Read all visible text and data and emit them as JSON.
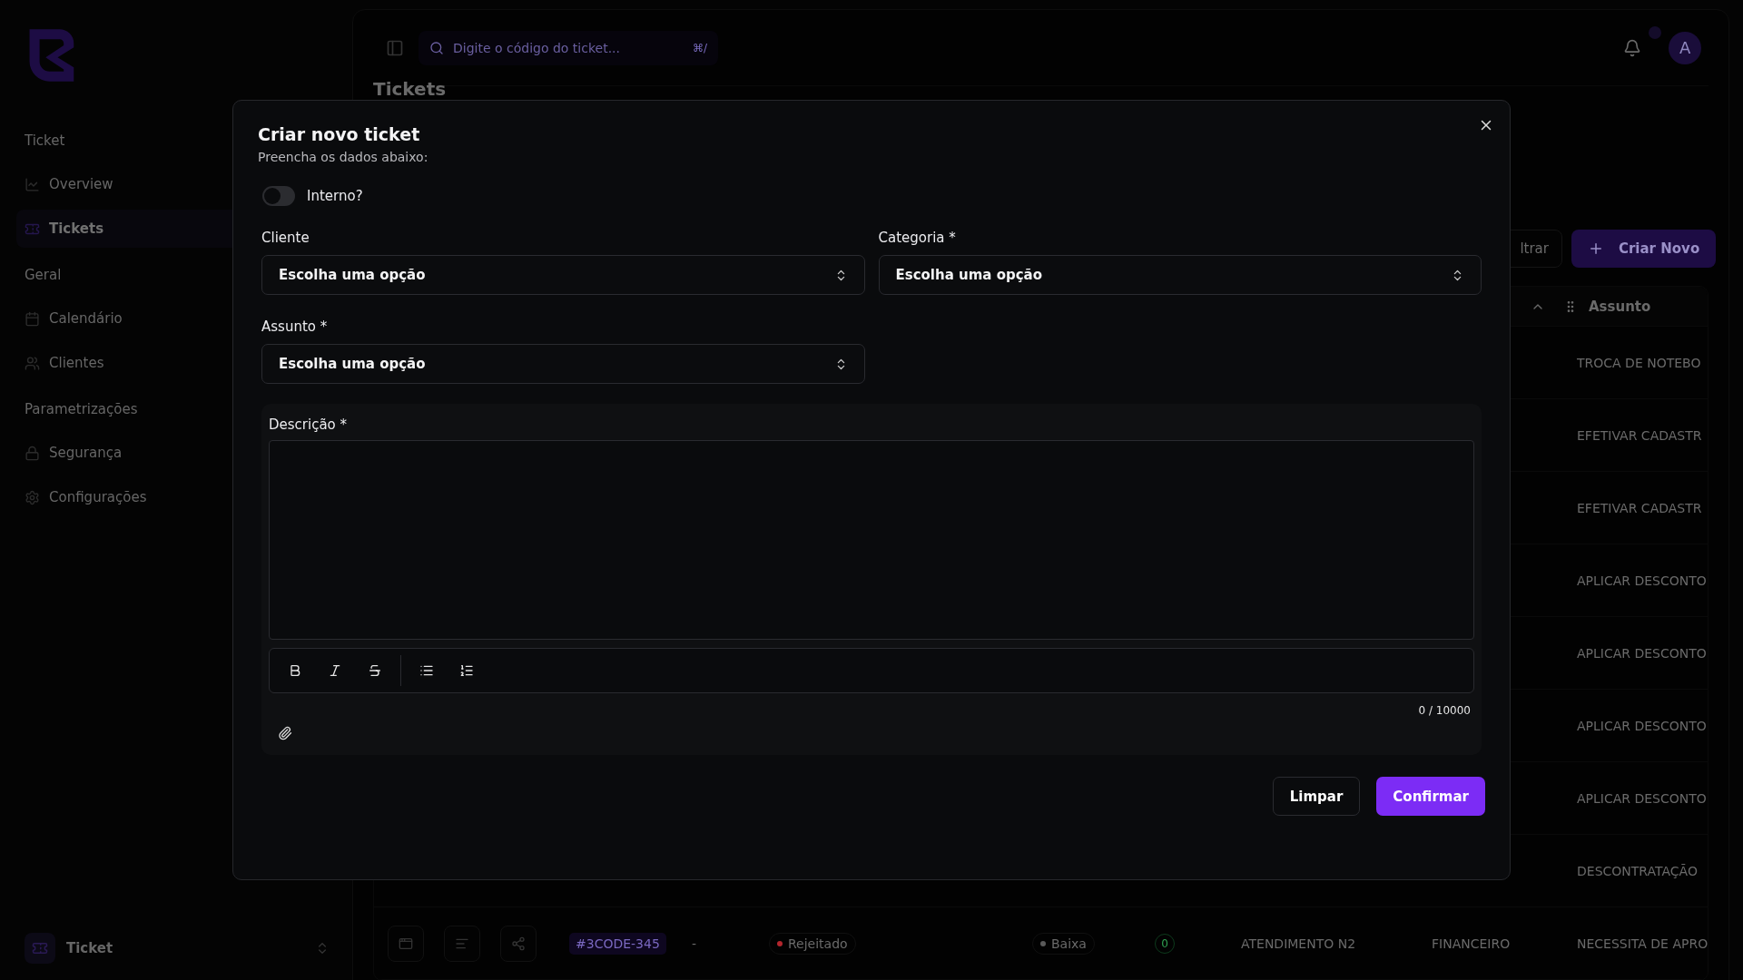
{
  "sidebar": {
    "sections": [
      {
        "title": "Ticket",
        "items": [
          {
            "label": "Overview",
            "selected": false
          },
          {
            "label": "Tickets",
            "selected": true
          }
        ]
      },
      {
        "title": "Geral",
        "items": [
          {
            "label": "Calendário",
            "selected": false
          },
          {
            "label": "Clientes",
            "selected": false
          }
        ]
      },
      {
        "title": "Parametrizações",
        "items": [
          {
            "label": "Segurança",
            "selected": false
          },
          {
            "label": "Configurações",
            "selected": false
          }
        ]
      }
    ],
    "workspace": {
      "name": "Ticket"
    }
  },
  "topbar": {
    "search": {
      "placeholder": "Digite o código do ticket...",
      "shortcut": "⌘/"
    },
    "avatar": "A"
  },
  "page": {
    "title": "Tickets",
    "filter_button": "ltrar",
    "create_button": "Criar Novo",
    "table": {
      "header": "Assunto",
      "rows": [
        {
          "assunto": "TROCA DE NOTEBO"
        },
        {
          "assunto": "EFETIVAR CADASTR"
        },
        {
          "assunto": "EFETIVAR CADASTR"
        },
        {
          "assunto": "APLICAR DESCONTO"
        },
        {
          "assunto": "APLICAR DESCONTO"
        },
        {
          "assunto": "APLICAR DESCONTO"
        },
        {
          "assunto": "APLICAR DESCONTO"
        },
        {
          "assunto": "DESCONTRATAÇÃO"
        },
        {
          "code": "#3CODE-345",
          "column_3": "-",
          "status": {
            "label": "Rejeitado",
            "color": "#b3262d"
          },
          "priority": {
            "label": "Baixa",
            "color": "#5a5a5a"
          },
          "count": "0",
          "column_7": "ATENDIMENTO N2",
          "column_8": "FINANCEIRO",
          "assunto": "NECESSITA DE APRO"
        }
      ]
    }
  },
  "dialog": {
    "title": "Criar novo ticket",
    "subtitle": "Preencha os dados abaixo:",
    "internal": {
      "label": "Interno?",
      "on": false
    },
    "fields": [
      {
        "label": "Cliente",
        "placeholder": "Escolha uma opção"
      },
      {
        "label": "Categoria *",
        "placeholder": "Escolha uma opção"
      },
      {
        "label": "Assunto *",
        "placeholder": "Escolha uma opção"
      }
    ],
    "description": {
      "label": "Descrição *",
      "counter": "0 / 10000"
    },
    "buttons": {
      "clear": "Limpar",
      "confirm": "Confirmar"
    }
  }
}
